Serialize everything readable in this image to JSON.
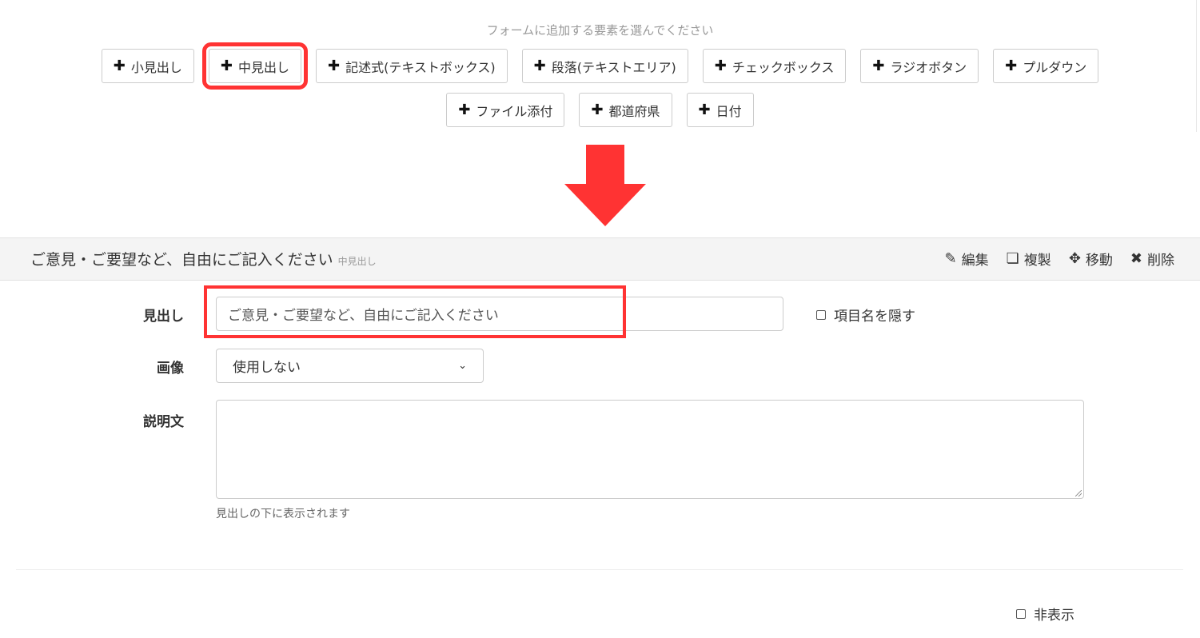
{
  "instruction": "フォームに追加する要素を選んでください",
  "add_buttons_row1": [
    "小見出し",
    "中見出し",
    "記述式(テキストボックス)",
    "段落(テキストエリア)",
    "チェックボックス",
    "ラジオボタン",
    "プルダウン"
  ],
  "add_buttons_row2": [
    "ファイル添付",
    "都道府県",
    "日付"
  ],
  "plus_icon": "✚",
  "panel": {
    "title": "ご意見・ご要望など、自由にご記入ください",
    "type_tag": "中見出し",
    "actions": {
      "edit": "編集",
      "duplicate": "複製",
      "move": "移動",
      "delete": "削除"
    }
  },
  "form": {
    "heading_label": "見出し",
    "heading_value": "ご意見・ご要望など、自由にご記入ください",
    "hide_item_name": "項目名を隠す",
    "image_label": "画像",
    "image_select_value": "使用しない",
    "description_label": "説明文",
    "description_value": "",
    "description_help": "見出しの下に表示されます"
  },
  "hidden_label": "非表示",
  "colors": {
    "highlight": "#ff3333",
    "header_bg": "#f4f4f4"
  }
}
